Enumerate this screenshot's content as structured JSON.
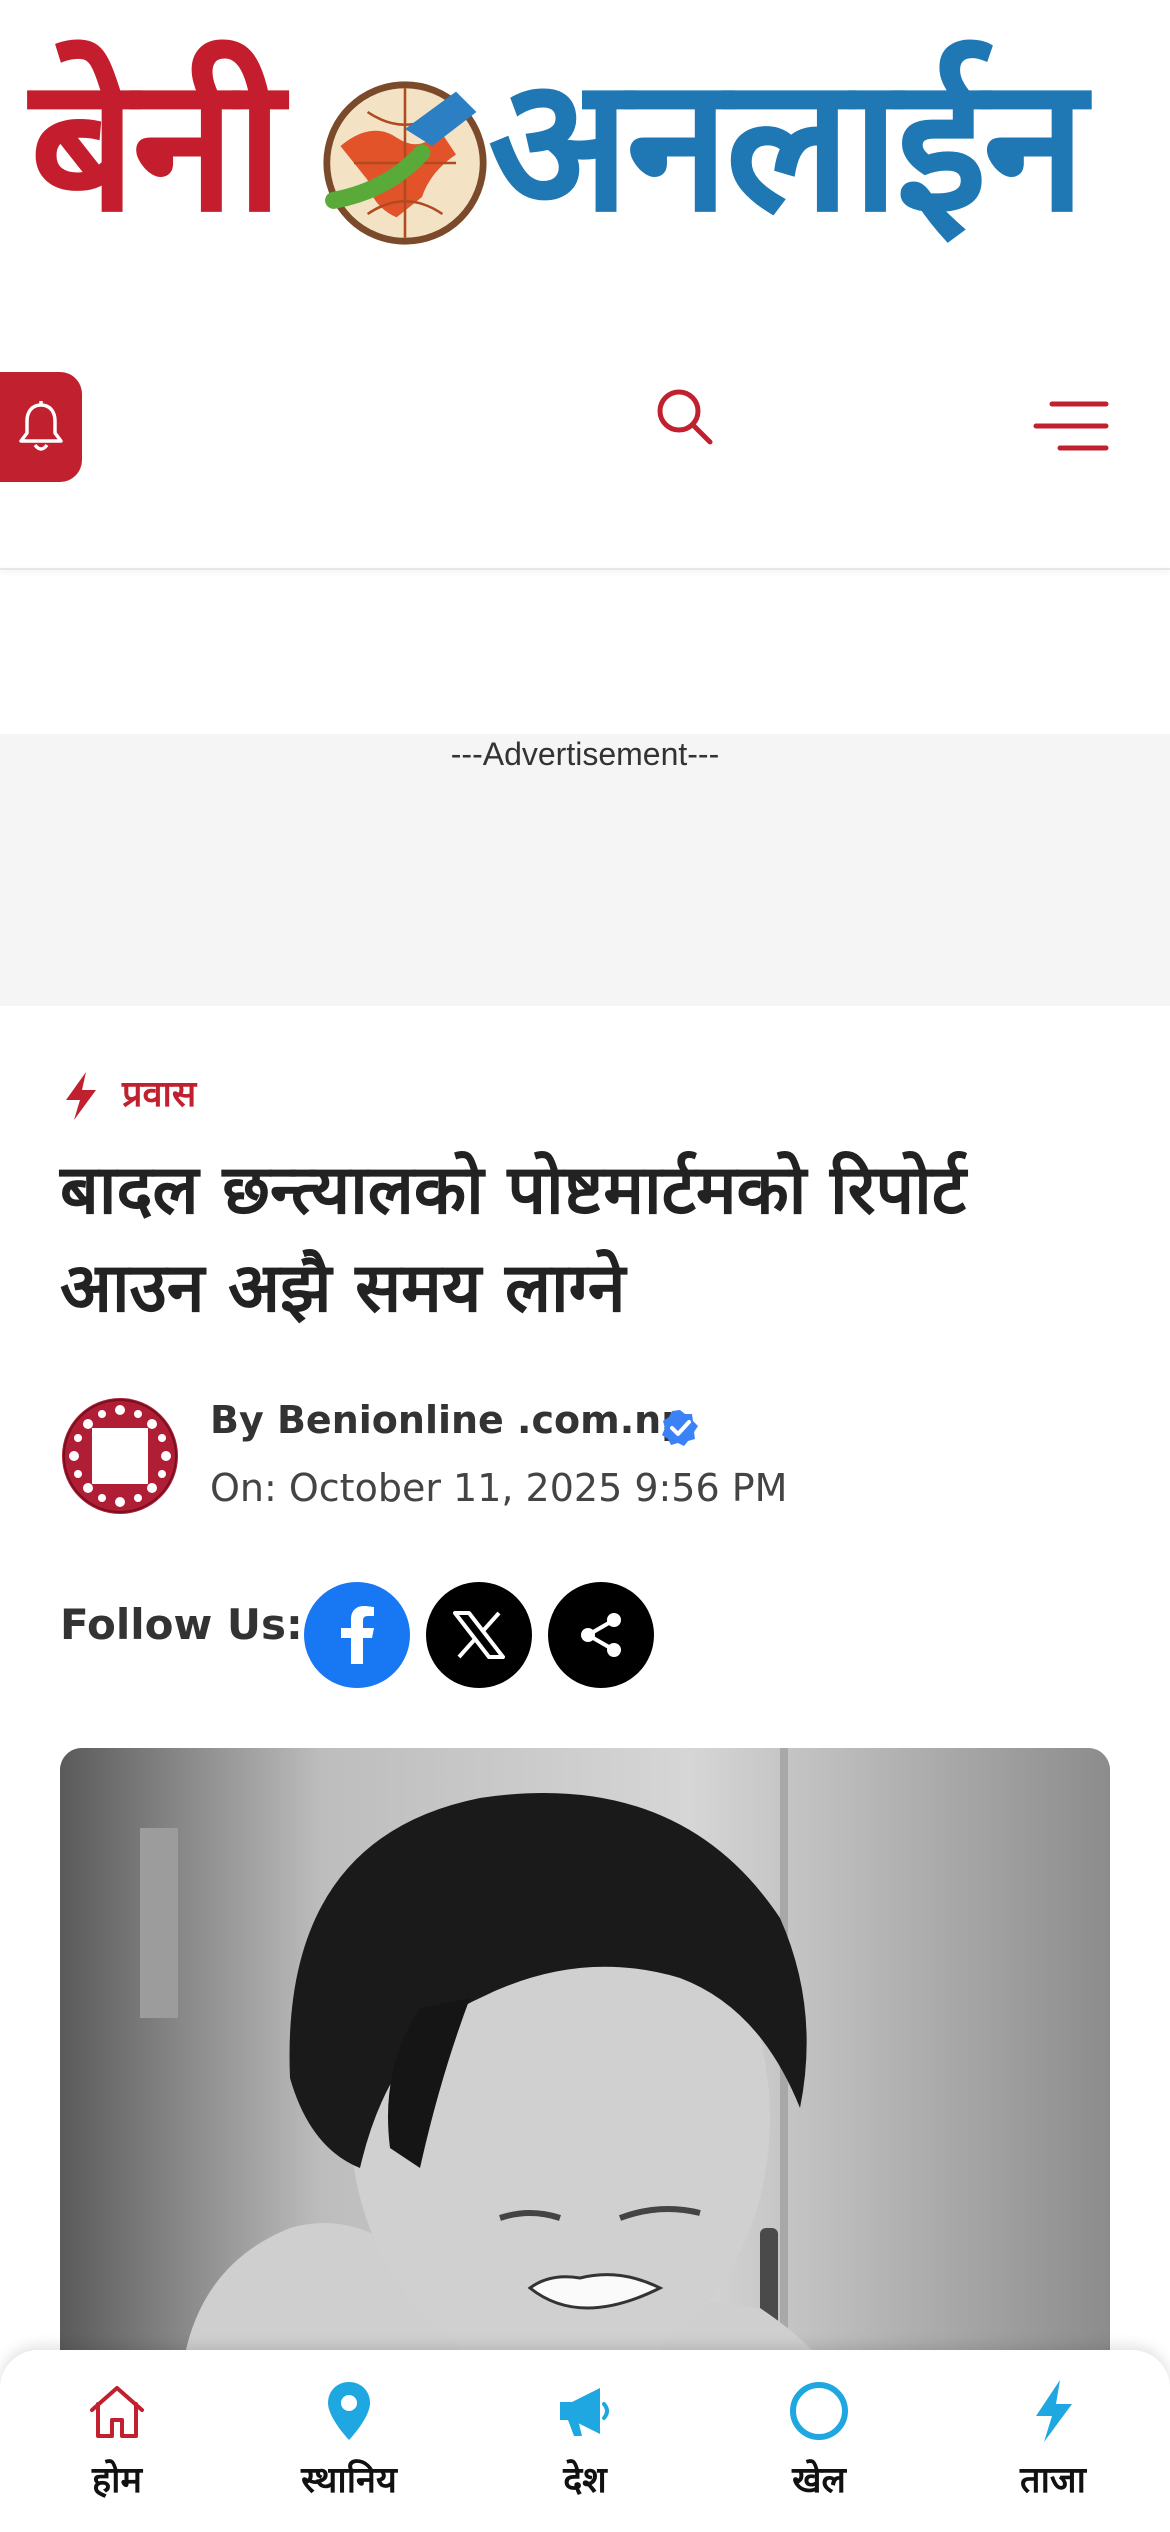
{
  "logo": {
    "part_red": "बेनी",
    "part_blue": "अनलाईन"
  },
  "header": {
    "icons": [
      "bell-icon",
      "search-icon",
      "menu-icon"
    ]
  },
  "ad": {
    "label": "---Advertisement---"
  },
  "article": {
    "category": "प्रवास",
    "headline": "बादल छन्त्यालको पोष्टमार्टमको रिपोर्ट आउन अझै समय लाग्ने",
    "author": "By Benionline .com.np",
    "date": "On: October 11, 2025 9:56 PM",
    "follow_label": "Follow Us:"
  },
  "bottom_nav": {
    "items": [
      {
        "label": "होम",
        "icon": "home-icon",
        "color": "#c1202e"
      },
      {
        "label": "स्थानिय",
        "icon": "location-pin-icon",
        "color": "#1ea7e0"
      },
      {
        "label": "देश",
        "icon": "megaphone-icon",
        "color": "#1ea7e0"
      },
      {
        "label": "खेल",
        "icon": "circle-icon",
        "color": "#1ea7e0"
      },
      {
        "label": "ताजा",
        "icon": "lightning-icon",
        "color": "#1ea7e0"
      }
    ]
  },
  "colors": {
    "brand_red": "#c1202e",
    "brand_blue": "#1f78b4",
    "facebook": "#1877f2"
  }
}
